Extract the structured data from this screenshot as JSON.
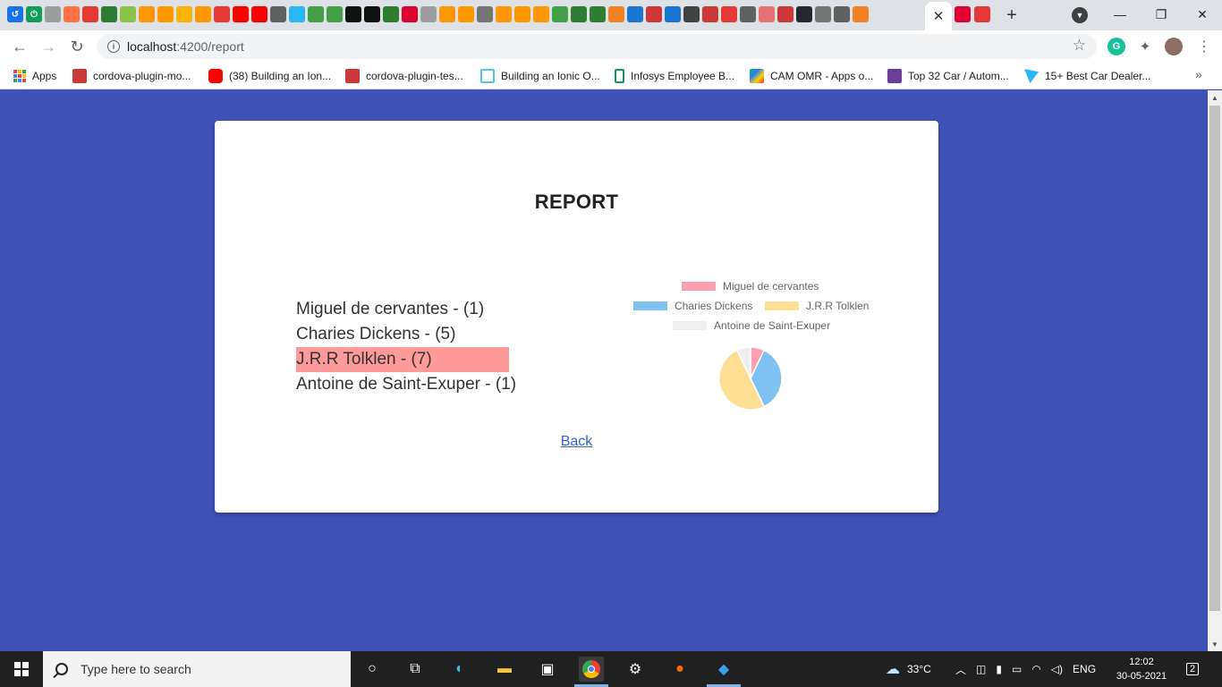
{
  "browser": {
    "address": {
      "host": "localhost",
      "port_path": ":4200/report"
    },
    "bookmarks": [
      {
        "label": "Apps",
        "icon": "apps-grid-icon",
        "color": "#4285f4"
      },
      {
        "label": "cordova-plugin-mo...",
        "icon": "npm-icon",
        "color": "#cb3837"
      },
      {
        "label": "(38) Building an Ion...",
        "icon": "youtube-icon",
        "color": "#ff0000"
      },
      {
        "label": "cordova-plugin-tes...",
        "icon": "npm-icon",
        "color": "#cb3837"
      },
      {
        "label": "Building an Ionic O...",
        "icon": "cube-icon",
        "color": "#4fc3f7"
      },
      {
        "label": "Infosys Employee B...",
        "icon": "phone-icon",
        "color": "#0f9d58"
      },
      {
        "label": "CAM OMR - Apps o...",
        "icon": "play-store-icon",
        "color": "#00c853"
      },
      {
        "label": "Top 32 Car / Autom...",
        "icon": "colorlib-icon",
        "color": "#6a3d9a"
      },
      {
        "label": "15+ Best Car Dealer...",
        "icon": "paper-plane-icon",
        "color": "#29b6f6"
      }
    ]
  },
  "report": {
    "title": "REPORT",
    "authors": [
      {
        "label": "Miguel de cervantes - (1)",
        "highlight": false
      },
      {
        "label": "Charies Dickens - (5)",
        "highlight": false
      },
      {
        "label": "J.R.R Tolklen - (7)",
        "highlight": true
      },
      {
        "label": "Antoine de Saint-Exuper - (1)",
        "highlight": false
      }
    ],
    "back_label": "Back",
    "highlight_color": "#ff9a9a"
  },
  "chart_data": {
    "type": "pie",
    "categories": [
      "Miguel de cervantes",
      "Charies Dickens",
      "J.R.R Tolklen",
      "Antoine de Saint-Exuper"
    ],
    "values": [
      1,
      5,
      7,
      1
    ],
    "colors": [
      "#ff9eb0",
      "#7fc1f0",
      "#ffdf94",
      "#f0f0f0"
    ],
    "legend_position": "top"
  },
  "taskbar": {
    "search_placeholder": "Type here to search",
    "weather": "33°C",
    "language": "ENG",
    "time": "12:02",
    "date": "30-05-2021",
    "notifications": "2"
  }
}
